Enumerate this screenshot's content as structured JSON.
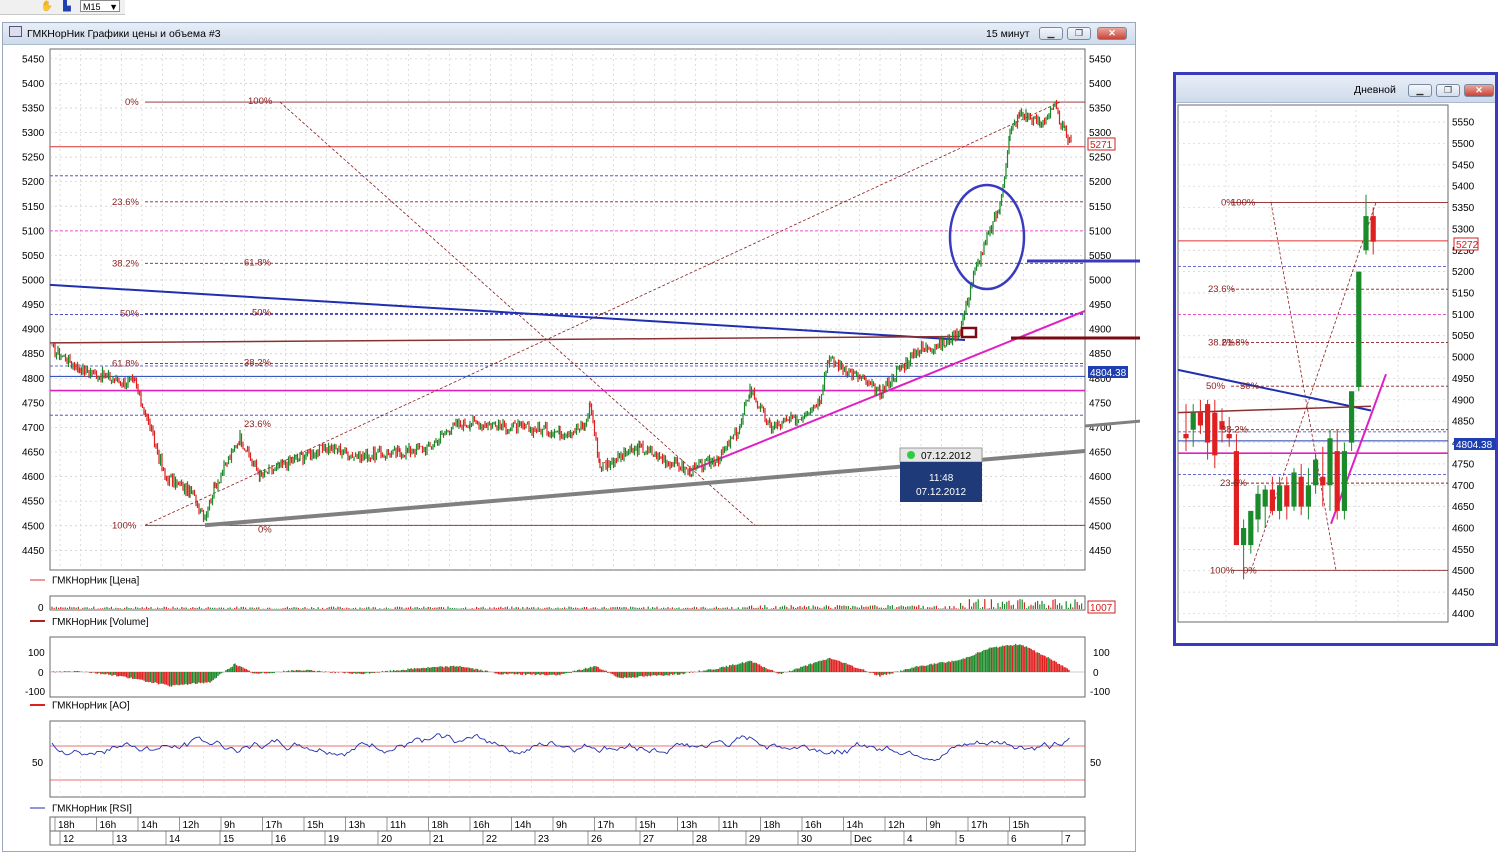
{
  "toolbar": {
    "timeframe": "M15",
    "dropdown_arrow": "▼",
    "icons": [
      "hand-icon",
      "chart-icon"
    ]
  },
  "main_window": {
    "title": "ГМКНорНик Графики цены и объема #3",
    "interval": "15 минут",
    "buttons": [
      "minimize",
      "maximize",
      "close"
    ]
  },
  "price_panel": {
    "y_ticks": [
      5450,
      5400,
      5350,
      5300,
      5250,
      5200,
      5150,
      5100,
      5050,
      5000,
      4950,
      4900,
      4850,
      4800,
      4750,
      4700,
      4650,
      4600,
      4550,
      4500,
      4450
    ],
    "ylim": [
      4410,
      5470
    ],
    "current_price_label": "5271",
    "level_label": "4804.38",
    "legend": "ГМКНорНик [Цена]",
    "fib_left": [
      {
        "pct": "0%",
        "v": 5362
      },
      {
        "pct": "23.6%",
        "v": 5159
      },
      {
        "pct": "38.2%",
        "v": 5034
      },
      {
        "pct": "50%",
        "v": 4932
      },
      {
        "pct": "61.8%",
        "v": 4830
      },
      {
        "pct": "100%",
        "v": 4501
      }
    ],
    "fib_right": [
      {
        "pct": "100%",
        "v": 5362
      },
      {
        "pct": "61.8%",
        "v": 5034
      },
      {
        "pct": "50%",
        "v": 4932
      },
      {
        "pct": "38.2%",
        "v": 4830
      },
      {
        "pct": "23.6%",
        "v": 4705
      },
      {
        "pct": "0%",
        "v": 4501
      }
    ],
    "tooltip": {
      "date": "07.12.2012",
      "time": "11:48",
      "date2": "07.12.2012"
    }
  },
  "volume_panel": {
    "legend": "ГМКНорНик [Volume]",
    "y_tick": "0",
    "value_label": "1007"
  },
  "ao_panel": {
    "legend": "ГМКНорНик [AO]",
    "y_ticks": [
      "100",
      "0",
      "-100"
    ]
  },
  "rsi_panel": {
    "legend": "ГМКНорНик [RSI]",
    "y_tick": "50"
  },
  "time_axis": {
    "hours": [
      "18h",
      "16h",
      "14h",
      "12h",
      "9h",
      "17h",
      "15h",
      "13h",
      "11h",
      "18h",
      "16h",
      "14h",
      "9h",
      "17h",
      "15h",
      "13h",
      "11h",
      "18h",
      "16h",
      "14h",
      "12h",
      "9h",
      "17h",
      "15h"
    ],
    "days": [
      "12",
      "13",
      "14",
      "15",
      "16",
      "19",
      "20",
      "21",
      "22",
      "23",
      "26",
      "27",
      "28",
      "29",
      "30",
      "Dec",
      "4",
      "5",
      "6",
      "7"
    ]
  },
  "daily_window": {
    "title": "Дневной",
    "y_ticks": [
      5550,
      5500,
      5450,
      5400,
      5350,
      5300,
      5250,
      5200,
      5150,
      5100,
      5050,
      5000,
      4950,
      4900,
      4850,
      4800,
      4750,
      4700,
      4650,
      4600,
      4550,
      4500,
      4450,
      4400
    ],
    "ylim": [
      4380,
      5590
    ],
    "current_price_label": "5272",
    "level_label": "4804.38",
    "fib_labels": [
      {
        "pct": "0%",
        "v": 5362
      },
      {
        "pct": "100%",
        "v": 5362
      },
      {
        "pct": "23.6%",
        "v": 5159
      },
      {
        "pct": "38.2%",
        "v": 5034
      },
      {
        "pct": "61.8%",
        "v": 5034
      },
      {
        "pct": "50%",
        "v": 4932
      },
      {
        "pct": "50%",
        "v": 4932
      },
      {
        "pct": "38.2%",
        "v": 4830
      },
      {
        "pct": "23.6%",
        "v": 4705
      },
      {
        "pct": "100%",
        "v": 4501
      },
      {
        "pct": "0%",
        "v": 4501
      }
    ]
  },
  "colors": {
    "up": "#1a8a2a",
    "down": "#e02020",
    "pink": "#e020c0",
    "blue_trend": "#1f2fb0",
    "fib": "#8b2020",
    "frame_blue": "#3a3ac0",
    "gray_trend": "#808080",
    "dark_red": "#7a0a14"
  },
  "chart_data": [
    {
      "type": "line",
      "title": "ГМКНорНик Графики цены и объема #3",
      "interval": "15 минут",
      "ylim": [
        4410,
        5470
      ],
      "x": [
        "12",
        "13",
        "14",
        "15",
        "16",
        "19",
        "20",
        "21",
        "22",
        "23",
        "26",
        "27",
        "28",
        "29",
        "30",
        "Dec",
        "4",
        "5",
        "6",
        "7"
      ],
      "series": [
        {
          "name": "ГМКНорНик [Цена]",
          "values": [
            4850,
            4790,
            4560,
            4620,
            4630,
            4640,
            4650,
            4670,
            4690,
            4680,
            4650,
            4640,
            4700,
            4720,
            4780,
            4790,
            4860,
            4980,
            5310,
            5271
          ]
        }
      ]
    },
    {
      "type": "line",
      "title": "Дневной",
      "ylim": [
        4380,
        5590
      ],
      "series": [
        {
          "name": "close",
          "values": [
            4800,
            4820,
            4760,
            4850,
            4560,
            4600,
            4640,
            4700,
            4680,
            4660,
            4720,
            4700,
            4900,
            5250,
            5272
          ]
        }
      ]
    }
  ]
}
